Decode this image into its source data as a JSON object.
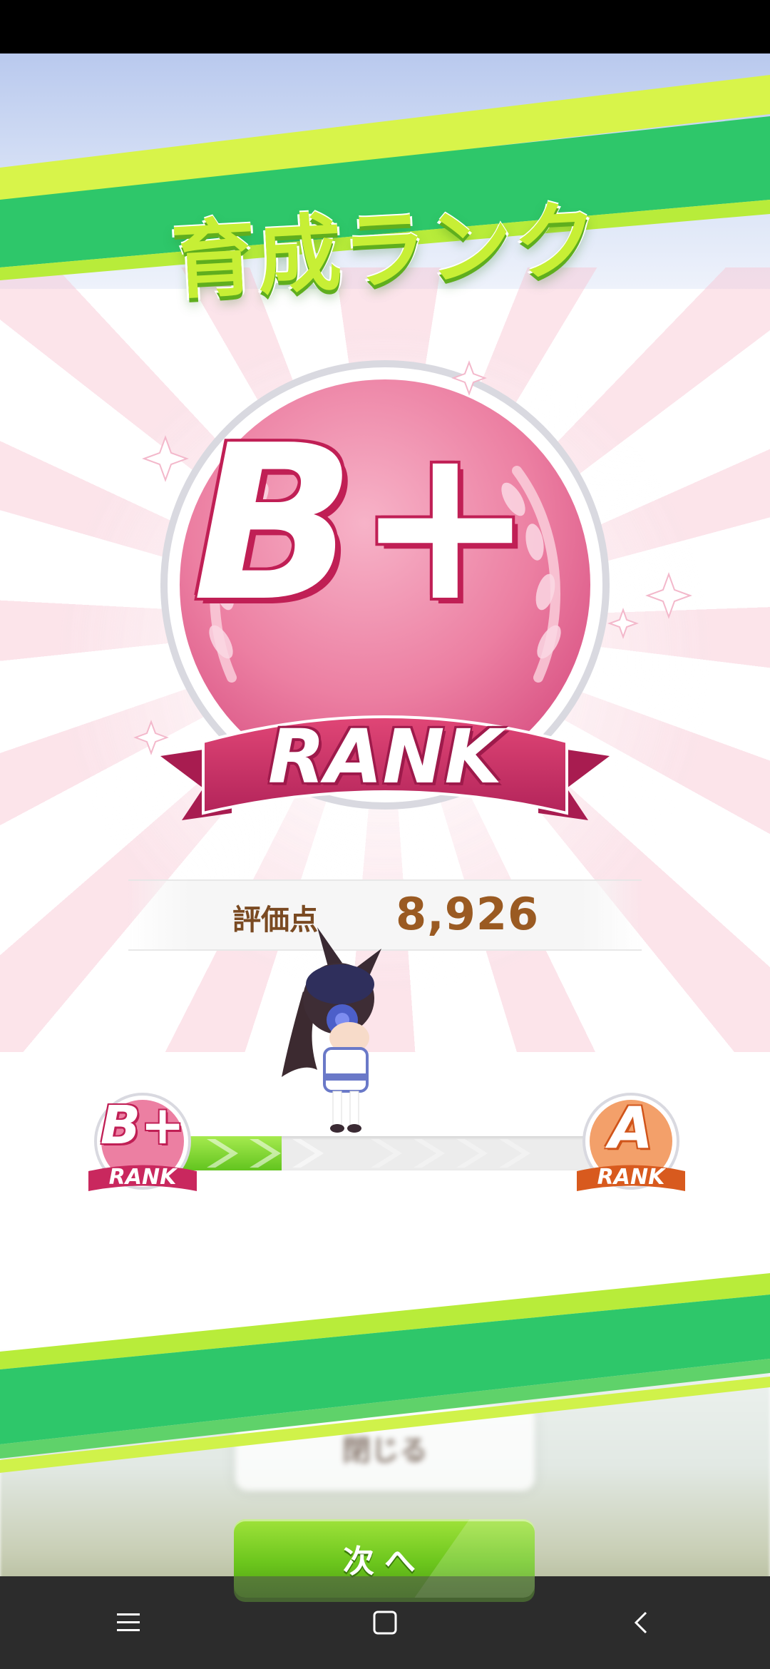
{
  "title": "育成ランク",
  "rank": {
    "letter": "B+",
    "label": "RANK"
  },
  "score": {
    "label": "評価点",
    "value": "8,926"
  },
  "progress": {
    "current_rank": "B+",
    "next_rank": "A",
    "rank_label": "RANK",
    "fraction": 0.25
  },
  "blurred_button": {
    "label": "閉じる"
  },
  "next_button": {
    "label": "次へ"
  },
  "colors": {
    "accent_green": "#6cc61d",
    "rank_pink": "#e0507e",
    "rank_a_orange": "#f07a3a",
    "score_brown": "#9a5a22"
  },
  "icons": [
    "menu-icon",
    "home-icon",
    "back-icon"
  ]
}
